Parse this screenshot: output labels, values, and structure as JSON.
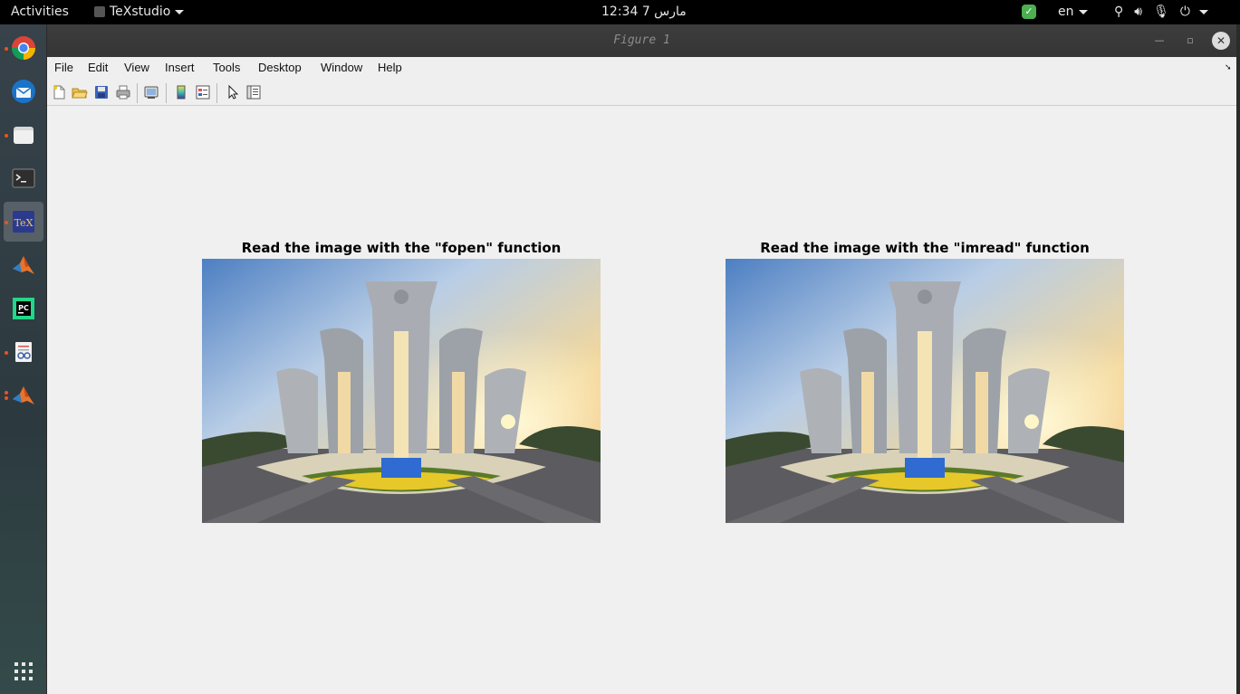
{
  "topbar": {
    "activities": "Activities",
    "app_name": "TeXstudio",
    "clock": "مارس 7  12:34",
    "lang": "en"
  },
  "dock": {
    "apps": [
      "chrome-icon",
      "thunderbird-icon",
      "files-icon",
      "terminal-icon",
      "texstudio-icon",
      "matlab-icon",
      "pycharm-icon",
      "document-viewer-icon",
      "matlab-icon-2",
      "show-apps-icon"
    ]
  },
  "window": {
    "title": "Figure 1",
    "menu": [
      "File",
      "Edit",
      "View",
      "Insert",
      "Tools",
      "Desktop",
      "Window",
      "Help"
    ]
  },
  "figure": {
    "subplots": [
      {
        "title": "Read the image with the \"fopen\" function"
      },
      {
        "title": "Read the image with the \"imread\" function"
      }
    ]
  },
  "colors": {
    "topbar": "#000000",
    "window_bg": "#efefef",
    "titlebar": "#3a3a3a"
  }
}
